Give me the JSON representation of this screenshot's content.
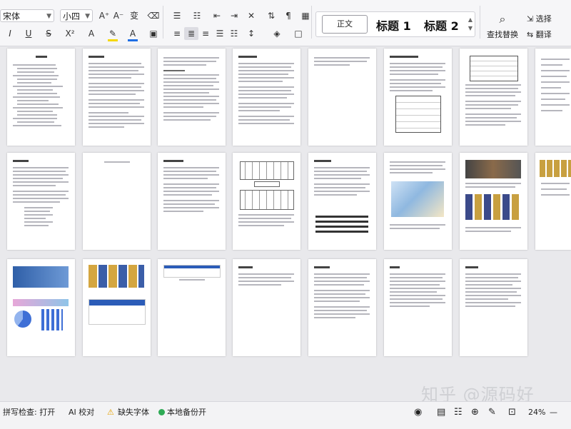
{
  "toolbar": {
    "font_name": "宋体",
    "font_size": "小四",
    "grow_font": "A⁺",
    "shrink_font": "A⁻",
    "phonetic": "变",
    "clear": "⌫",
    "underline": "U",
    "strike": "S",
    "superscript": "X²",
    "text_effect": "A",
    "highlight": "✎",
    "font_color": "A"
  },
  "styles": {
    "normal": "正文",
    "heading1": "标题 1",
    "heading2": "标题 2"
  },
  "tools": {
    "find_replace": "查找替换",
    "select": "选择",
    "translate": "翻译"
  },
  "watermark": "知乎 @源码好",
  "status": {
    "spellcheck": "拼写检查: 打开",
    "ai_check": "AI 校对",
    "missing_font": "缺失字体",
    "local_backup": "本地备份开",
    "zoom": "24%"
  },
  "colors": {
    "font_color_bar": "#1f6fe5",
    "highlight_bar": "#f5d800",
    "ok": "#2eaa55",
    "warning": "#e6a100"
  }
}
